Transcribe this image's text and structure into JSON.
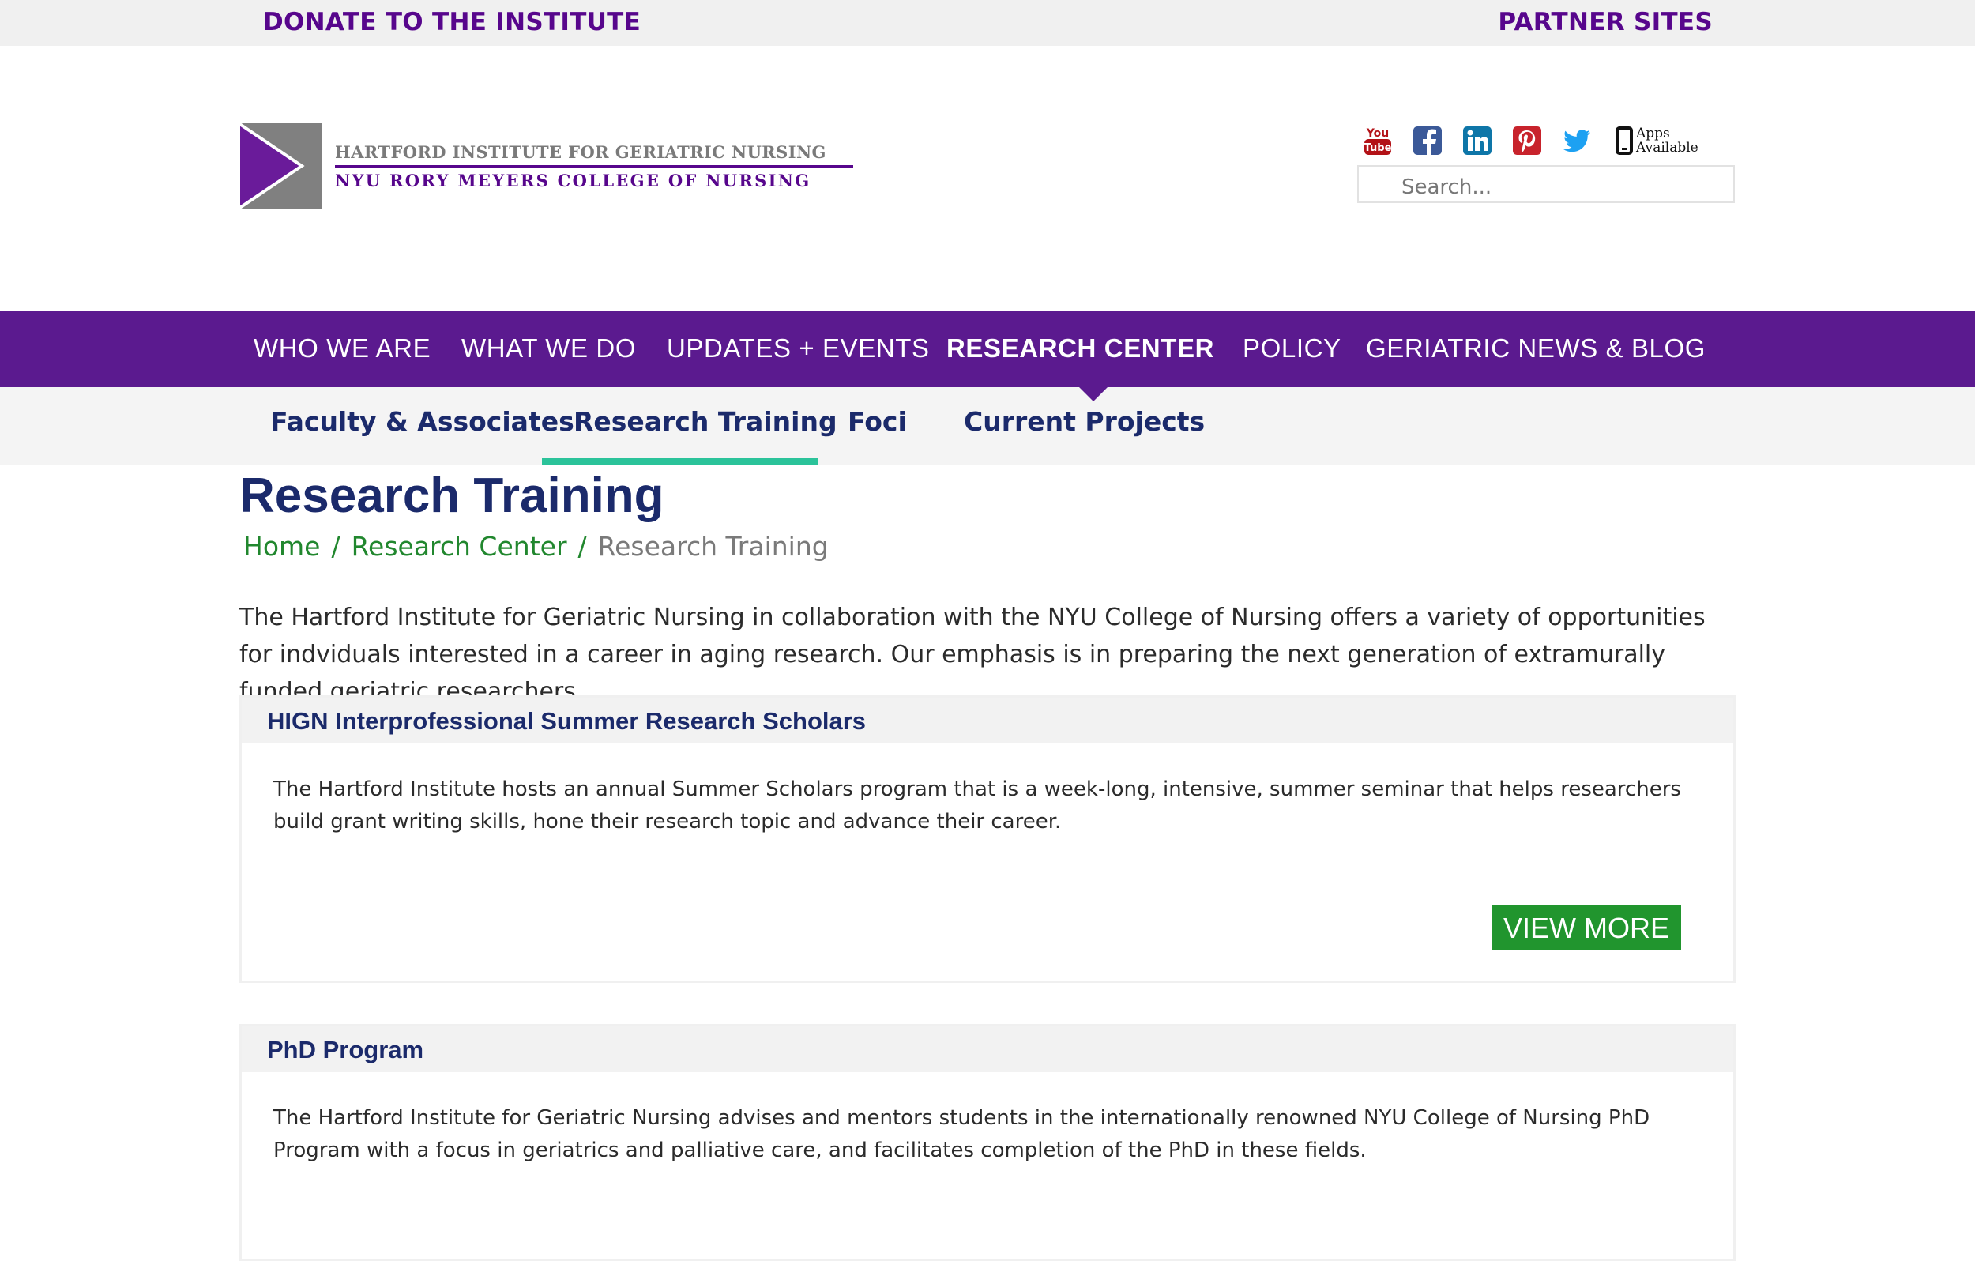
{
  "topbar": {
    "donate": "DONATE TO THE INSTITUTE",
    "partner_sites": "PARTNER SITES"
  },
  "logo": {
    "line1": "HARTFORD INSTITUTE FOR GERIATRIC NURSING",
    "line2": "NYU RORY MEYERS COLLEGE OF NURSING",
    "mark_color": "#808080",
    "accent_color": "#57068c"
  },
  "social": {
    "icons": [
      "youtube-icon",
      "facebook-icon",
      "linkedin-icon",
      "pinterest-icon",
      "twitter-icon",
      "mobile-phone-icon"
    ],
    "youtube_text": [
      "You",
      "Tube"
    ],
    "apps_line1": "Apps",
    "apps_line2": "Available"
  },
  "search": {
    "placeholder": "Search..."
  },
  "main_nav": {
    "items": [
      "WHO WE ARE",
      "WHAT WE DO",
      "UPDATES + EVENTS",
      "RESEARCH CENTER",
      "POLICY",
      "GERIATRIC NEWS & BLOG"
    ],
    "active": "RESEARCH CENTER",
    "bg_color": "#5b1a8f"
  },
  "sub_nav": {
    "items": [
      "Faculty & Associates",
      "Research Training",
      "Foci",
      "Current Projects"
    ],
    "active": "Research Training",
    "underline_color": "#2bc39a"
  },
  "page": {
    "title": "Research Training",
    "breadcrumb": {
      "home": "Home",
      "sep": "/",
      "section": "Research Center",
      "current": "Research Training"
    },
    "intro": "The Hartford Institute for Geriatric Nursing in collaboration with the NYU College of Nursing offers a variety of opportunities for indviduals interested in a career in aging research. Our emphasis is in preparing the next generation of extramurally funded geriatric researchers."
  },
  "cards": [
    {
      "title": "HIGN Interprofessional Summer Research Scholars",
      "body": "The Hartford Institute hosts an annual Summer Scholars program that is a week-long, intensive, summer seminar that helps researchers build grant writing skills, hone their research topic and advance their career.",
      "button": "VIEW MORE"
    },
    {
      "title": "PhD Program",
      "body": "The Hartford Institute for Geriatric Nursing advises and mentors students in the internationally renowned NYU College of Nursing PhD Program with a focus in geriatrics and palliative care, and facilitates completion of the PhD in these fields."
    }
  ],
  "colors": {
    "heading_navy": "#1b2a6b",
    "link_green": "#21872e",
    "button_green": "#21952e"
  }
}
